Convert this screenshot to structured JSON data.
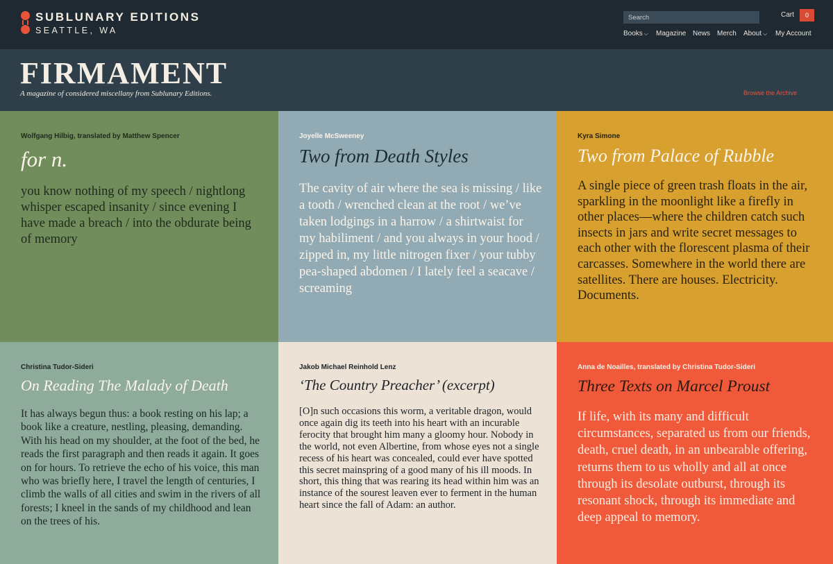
{
  "brand": {
    "name": "SUBLUNARY EDITIONS",
    "location": "SEATTLE, WA"
  },
  "search": {
    "placeholder": "Search"
  },
  "cart": {
    "label": "Cart",
    "count": "0"
  },
  "nav": {
    "books": "Books",
    "magazine": "Magazine",
    "news": "News",
    "merch": "Merch",
    "about": "About",
    "account": "My Account"
  },
  "hero": {
    "title": "FIRMAMENT",
    "subtitle": "A magazine of considered miscellany from Sublunary Editions.",
    "archive_link": "Browse the Archive"
  },
  "tiles": [
    {
      "author": "Wolfgang Hilbig, translated by Matthew Spencer",
      "title": "for n.",
      "body": "you know nothing of my speech / nightlong whisper escaped insanity / since evening I have made a breach / into the obdurate being of memory",
      "color": "#718d5c"
    },
    {
      "author": "Joyelle McSweeney",
      "title": "Two from Death Styles",
      "body": "The cavity of air where the sea is missing / like a tooth / wrenched clean at the root / we’ve taken lodgings in a harrow / a shirtwaist for my habiliment / and you always in your hood / zipped in, my little nitrogen fixer / your tubby pea-shaped abdomen / I lately feel a seacave / screaming",
      "color": "#92aab3"
    },
    {
      "author": "Kyra Simone",
      "title": "Two from Palace of Rubble",
      "body": "A single piece of green trash floats in the air, sparkling in the moonlight like a firefly in other places—where the children catch such insects in jars and write secret messages to each other with the florescent plasma of their carcasses. Somewhere in the world there are satellites. There are houses. Electricity. Documents.",
      "color": "#d8a02e"
    },
    {
      "author": "Christina Tudor-Sideri",
      "title": "On Reading The Malady of Death",
      "body": "It has always begun thus: a book resting on his lap; a book like a creature, nestling, pleasing, demanding. With his head on my shoulder, at the foot of the bed, he reads the first paragraph and then reads it again. It goes on for hours. To retrieve the echo of his voice, this man who was briefly here, I travel the length of centuries, I climb the walls of all cities and swim in the rivers of all forests; I kneel in the sands of my childhood and lean on the trees of his.",
      "color": "#8fab9b"
    },
    {
      "author": "Jakob Michael Reinhold Lenz",
      "title": "‘The Country Preacher’ (excerpt)",
      "body": "[O]n such occasions this worm, a veritable dragon, would once again dig its teeth into his heart with an incurable ferocity that brought him many a gloomy hour. Nobody in the world, not even Albertine, from whose eyes not a single recess of his heart was concealed, could ever have spotted this secret mainspring of a good many of his ill moods. In short, this thing that was rearing its head within him was an instance of the sourest leaven ever to ferment in the human heart since the fall of Adam: an author.",
      "color": "#ece3d6"
    },
    {
      "author": "Anna de Noailles, translated by Christina Tudor-Sideri",
      "title": "Three Texts on Marcel Proust",
      "body": "If life, with its many and difficult circumstances, separated us from our friends, death, cruel death, in an unbearable offering, returns them to us wholly and all at once through its desolate outburst, through its resonant shock, through its immediate and deep appeal to memory.",
      "color": "#f0593a"
    }
  ]
}
